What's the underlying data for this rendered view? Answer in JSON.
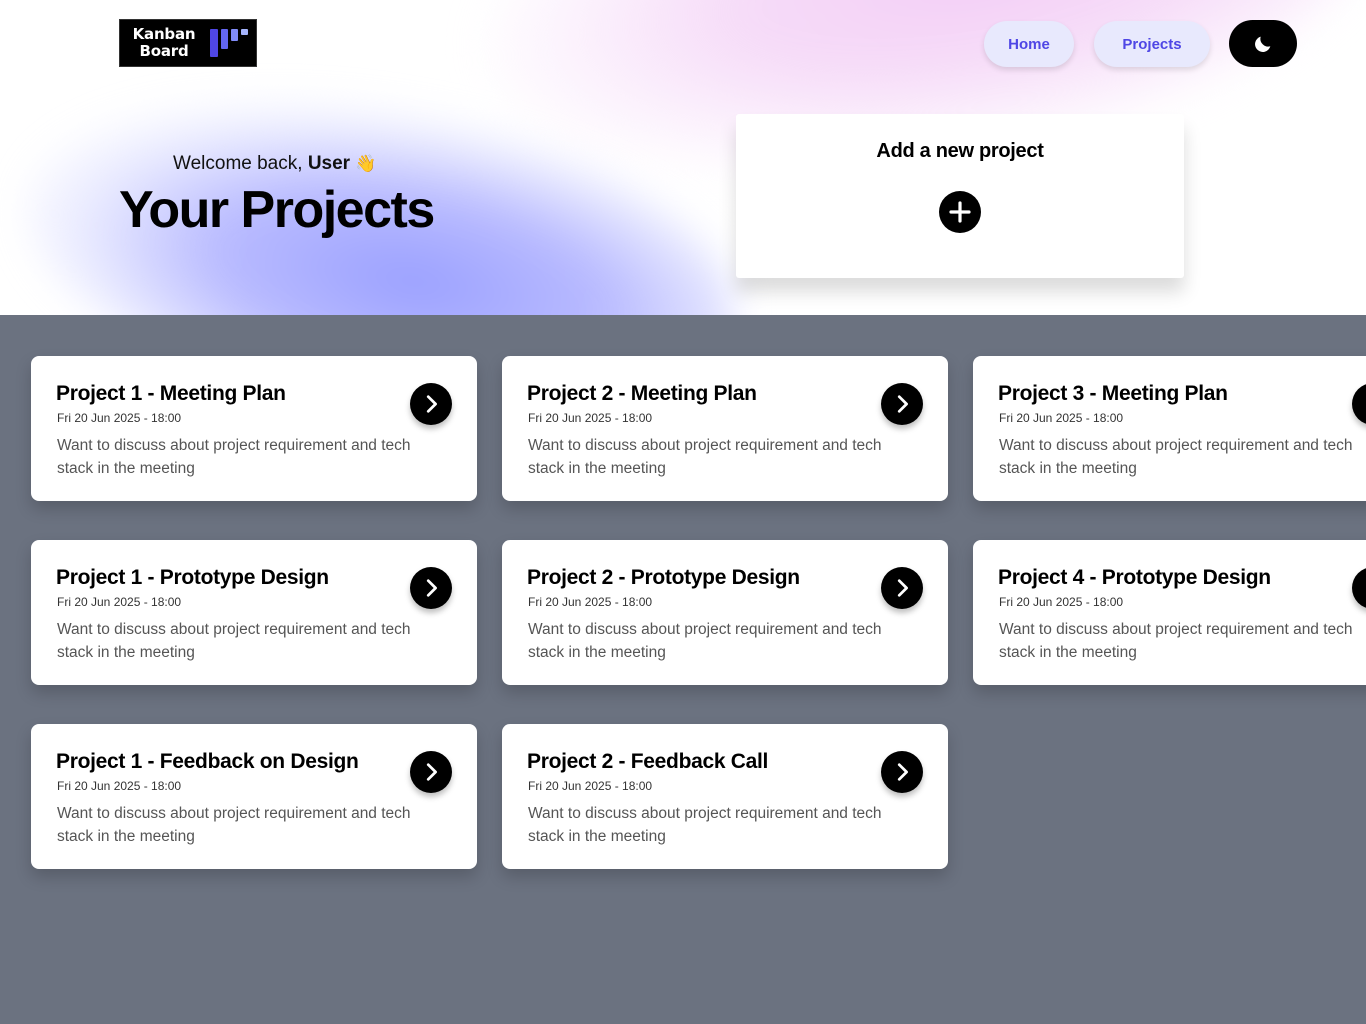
{
  "header": {
    "logo_line1": "Kanban",
    "logo_line2": "Board",
    "nav": {
      "home_label": "Home",
      "projects_label": "Projects"
    },
    "theme_toggle_icon": "moon-icon"
  },
  "hero": {
    "welcome_prefix": "Welcome back, ",
    "welcome_user": "User",
    "welcome_emoji": "👋",
    "title": "Your Projects"
  },
  "add_project": {
    "title": "Add a new project",
    "icon": "plus-icon"
  },
  "colors": {
    "accent": "#4f46e5",
    "nav_button_bg": "#e8e9fd",
    "page_bg": "#6b7280",
    "card_bg": "#ffffff"
  },
  "projects": [
    {
      "title": "Project 1 - Meeting Plan",
      "date": "Fri 20 Jun 2025 - 18:00",
      "description": "Want to discuss about project requirement and tech stack in the meeting"
    },
    {
      "title": "Project 2 - Meeting Plan",
      "date": "Fri 20 Jun 2025 - 18:00",
      "description": "Want to discuss about project requirement and tech stack in the meeting"
    },
    {
      "title": "Project 3 - Meeting Plan",
      "date": "Fri 20 Jun 2025 - 18:00",
      "description": "Want to discuss about project requirement and tech stack in the meeting"
    },
    {
      "title": "Project 1 - Prototype Design",
      "date": "Fri 20 Jun 2025 - 18:00",
      "description": "Want to discuss about project requirement and tech stack in the meeting"
    },
    {
      "title": "Project 2 - Prototype Design",
      "date": "Fri 20 Jun 2025 - 18:00",
      "description": "Want to discuss about project requirement and tech stack in the meeting"
    },
    {
      "title": "Project 4 - Prototype Design",
      "date": "Fri 20 Jun 2025 - 18:00",
      "description": "Want to discuss about project requirement and tech stack in the meeting"
    },
    {
      "title": "Project 1 - Feedback on Design",
      "date": "Fri 20 Jun 2025 - 18:00",
      "description": "Want to discuss about project requirement and tech stack in the meeting"
    },
    {
      "title": "Project 2 - Feedback Call",
      "date": "Fri 20 Jun 2025 - 18:00",
      "description": "Want to discuss about project requirement and tech stack in the meeting"
    }
  ]
}
